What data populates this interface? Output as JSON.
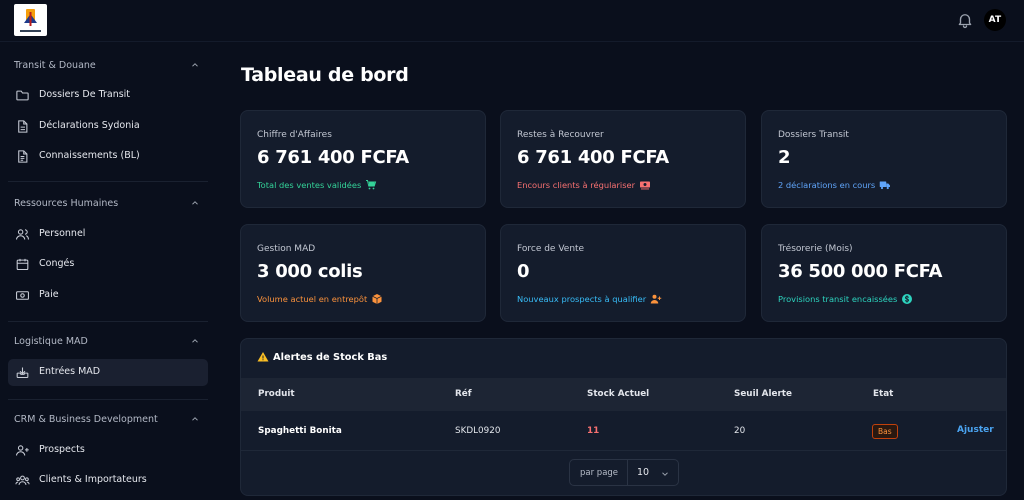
{
  "header": {
    "avatar_initials": "AT"
  },
  "sidebar": {
    "sections": [
      {
        "title": "Transit & Douane",
        "items": [
          {
            "label": "Dossiers De Transit",
            "icon": "folder-icon"
          },
          {
            "label": "Déclarations Sydonia",
            "icon": "document-icon"
          },
          {
            "label": "Connaissements (BL)",
            "icon": "document-lines-icon"
          }
        ]
      },
      {
        "title": "Ressources Humaines",
        "items": [
          {
            "label": "Personnel",
            "icon": "users-icon"
          },
          {
            "label": "Congés",
            "icon": "calendar-icon"
          },
          {
            "label": "Paie",
            "icon": "banknote-icon"
          }
        ]
      },
      {
        "title": "Logistique MAD",
        "items": [
          {
            "label": "Entrées MAD",
            "icon": "inbox-download-icon",
            "active": true
          }
        ]
      },
      {
        "title": "CRM & Business Development",
        "items": [
          {
            "label": "Prospects",
            "icon": "user-plus-icon"
          },
          {
            "label": "Clients & Importateurs",
            "icon": "users-group-icon"
          }
        ]
      }
    ]
  },
  "main": {
    "title": "Tableau de bord",
    "cards": [
      {
        "label": "Chiffre d'Affaires",
        "value": "6 761 400 FCFA",
        "sub": "Total des ventes validées",
        "color": "#34d399",
        "icon": "cart-icon"
      },
      {
        "label": "Restes à Recouvrer",
        "value": "6 761 400 FCFA",
        "sub": "Encours clients à régulariser",
        "color": "#f87171",
        "icon": "money-icon"
      },
      {
        "label": "Dossiers Transit",
        "value": "2",
        "sub": "2 déclarations en cours",
        "color": "#60a5fa",
        "icon": "truck-icon"
      },
      {
        "label": "Gestion MAD",
        "value": "3 000 colis",
        "sub": "Volume actuel en entrepôt",
        "color": "#fb923c",
        "icon": "box-icon"
      },
      {
        "label": "Force de Vente",
        "value": "0",
        "sub": "Nouveaux prospects à qualifier",
        "color": "#38bdf8",
        "icon": "user-plus-icon"
      },
      {
        "label": "Trésorerie (Mois)",
        "value": "36 500 000 FCFA",
        "sub": "Provisions transit encaissées",
        "color": "#2dd4bf",
        "icon": "dollar-coin-icon"
      }
    ],
    "alerts": {
      "title": "Alertes de Stock Bas",
      "columns": [
        "Produit",
        "Réf",
        "Stock Actuel",
        "Seuil Alerte",
        "Etat"
      ],
      "rows": [
        {
          "product": "Spaghetti Bonita",
          "ref": "SKDL0920",
          "stock": "11",
          "threshold": "20",
          "state": "Bas",
          "action": "Ajuster"
        }
      ],
      "pager": {
        "label": "par page",
        "value": "10"
      }
    }
  },
  "colors": {
    "background": "#0a0f1c",
    "card": "#141c2c",
    "stock_low": "#f87171",
    "link": "#4aa3f0"
  }
}
